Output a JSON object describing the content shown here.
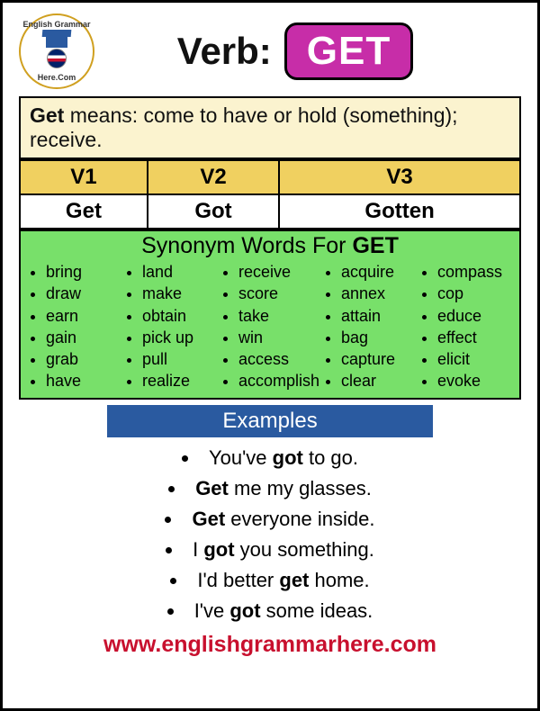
{
  "logo": {
    "top": "English Grammar",
    "bottom": "Here.Com"
  },
  "header": {
    "label": "Verb:",
    "verb": "GET"
  },
  "definition": {
    "term": "Get",
    "text": " means: come to have or hold (something); receive."
  },
  "forms": {
    "headers": [
      "V1",
      "V2",
      "V3"
    ],
    "values": [
      "Get",
      "Got",
      "Gotten"
    ]
  },
  "synonyms": {
    "title_prefix": "Synonym Words For ",
    "title_verb": "GET",
    "cols": [
      [
        "bring",
        "draw",
        "earn",
        "gain",
        "grab",
        "have"
      ],
      [
        "land",
        "make",
        "obtain",
        "pick up",
        "pull",
        "realize"
      ],
      [
        "receive",
        "score",
        "take",
        "win",
        "access",
        "accomplish"
      ],
      [
        "acquire",
        "annex",
        "attain",
        "bag",
        "capture",
        "clear"
      ],
      [
        "compass",
        "cop",
        "educe",
        "effect",
        "elicit",
        "evoke"
      ]
    ]
  },
  "examples": {
    "title": "Examples",
    "items": [
      {
        "pre": "You've ",
        "bold": "got",
        "post": " to go."
      },
      {
        "pre": "",
        "bold": "Get",
        "post": " me my glasses."
      },
      {
        "pre": "",
        "bold": "Get",
        "post": " everyone inside."
      },
      {
        "pre": "I ",
        "bold": "got",
        "post": " you something."
      },
      {
        "pre": "I'd better ",
        "bold": "get",
        "post": " home."
      },
      {
        "pre": "I've ",
        "bold": "got",
        "post": " some ideas."
      }
    ]
  },
  "footer": "www.englishgrammarhere.com"
}
